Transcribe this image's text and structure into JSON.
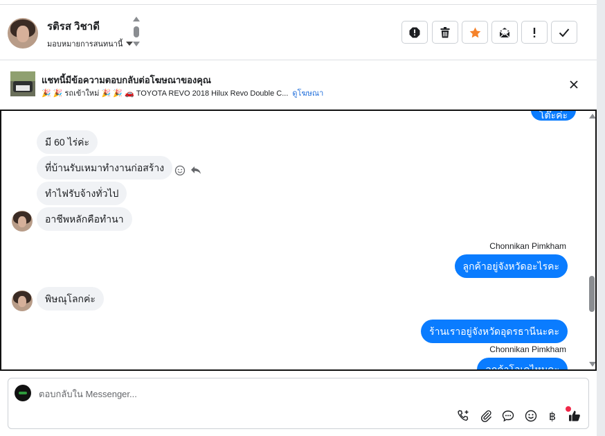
{
  "header": {
    "contact_name": "รติรส วิชาดี",
    "assign_label": "มอบหมายการสนทนานี้",
    "actions": [
      "spam-icon",
      "trash-icon",
      "star-icon",
      "mark-unread-icon",
      "follow-up-icon",
      "done-icon"
    ],
    "star_color": "#f5822a"
  },
  "ad": {
    "title": "แชทนี้มีข้อความตอบกลับต่อโฆษณาของคุณ",
    "subtitle": "🎉 🎉 รถเข้าใหม่ 🎉 🎉 🚗 TOYOTA REVO 2018 Hilux Revo Double C...",
    "link": "ดูโฆษณา"
  },
  "conversation": {
    "partial_top": "โต๊ะค่ะ",
    "messages": [
      {
        "dir": "in",
        "text": "มี 60 ไร่ค่ะ"
      },
      {
        "dir": "in",
        "text": "ที่บ้านรับเหมาทำงานก่อสร้าง"
      },
      {
        "dir": "in",
        "text": "ทำไฟรับจ้างทั่วไป"
      },
      {
        "dir": "in",
        "text": "อาชีพหลักคือทำนา"
      },
      {
        "dir": "out",
        "sender": "Chonnikan Pimkham",
        "text": "ลูกค้าอยู่จังหวัดอะไรคะ"
      },
      {
        "dir": "in",
        "text": "พิษณุโลกค่ะ"
      },
      {
        "dir": "out",
        "text": "ร้านเราอยู่จังหวัดอุดรธานีนะคะ"
      },
      {
        "dir": "out",
        "sender": "Chonnikan Pimkham",
        "text": "ลูกค้าโอเคไหมคะ"
      }
    ],
    "accent_color": "#0a7cff"
  },
  "composer": {
    "placeholder": "ตอบกลับใน Messenger...",
    "icons": [
      "call-add-icon",
      "attachment-icon",
      "saved-replies-icon",
      "emoji-icon",
      "payment-icon",
      "thumbs-up-icon"
    ]
  }
}
